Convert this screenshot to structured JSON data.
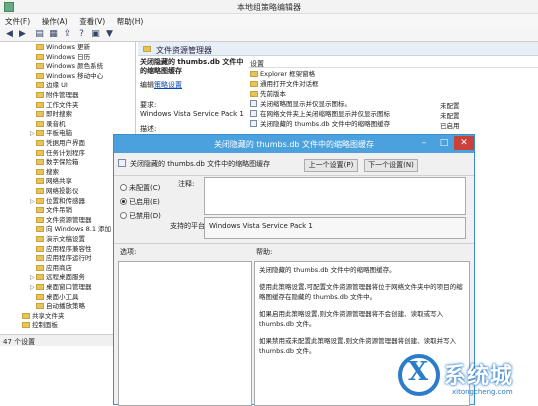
{
  "window": {
    "title": "本地组策略编辑器",
    "menu": [
      "文件(F)",
      "操作(A)",
      "查看(V)",
      "帮助(H)"
    ],
    "status": "47 个设置"
  },
  "tree": [
    {
      "label": "Windows 更新",
      "exp": ""
    },
    {
      "label": "Windows 日历",
      "exp": ""
    },
    {
      "label": "Windows 颜色系统",
      "exp": ""
    },
    {
      "label": "Windows 移动中心",
      "exp": ""
    },
    {
      "label": "边缘 UI",
      "exp": ""
    },
    {
      "label": "附件管理器",
      "exp": ""
    },
    {
      "label": "工作文件夹",
      "exp": ""
    },
    {
      "label": "即时搜索",
      "exp": ""
    },
    {
      "label": "录音机",
      "exp": ""
    },
    {
      "label": "平板电脑",
      "exp": "▷"
    },
    {
      "label": "凭据用户界面",
      "exp": ""
    },
    {
      "label": "任务计划程序",
      "exp": ""
    },
    {
      "label": "数字保险箱",
      "exp": ""
    },
    {
      "label": "搜索",
      "exp": ""
    },
    {
      "label": "网络共享",
      "exp": ""
    },
    {
      "label": "网络投影仪",
      "exp": ""
    },
    {
      "label": "位置和传感器",
      "exp": "▷"
    },
    {
      "label": "文件吊销",
      "exp": ""
    },
    {
      "label": "文件资源管理器",
      "exp": ""
    },
    {
      "label": "向 Windows 8.1 添加",
      "exp": ""
    },
    {
      "label": "演示文稿设置",
      "exp": ""
    },
    {
      "label": "应用程序兼容性",
      "exp": ""
    },
    {
      "label": "应用程序运行时",
      "exp": ""
    },
    {
      "label": "应用商店",
      "exp": ""
    },
    {
      "label": "远程桌面服务",
      "exp": "▷"
    },
    {
      "label": "桌面窗口管理器",
      "exp": "▷"
    },
    {
      "label": "桌面小工具",
      "exp": ""
    },
    {
      "label": "自动播放策略",
      "exp": ""
    },
    {
      "label": "共享文件夹",
      "exp": ""
    },
    {
      "label": "控制面板",
      "exp": ""
    }
  ],
  "panel": {
    "header": "文件资源管理器",
    "desc_title": "关闭隐藏的 thumbs.db 文件中的缩略图缓存",
    "edit_prefix": "编辑",
    "edit_link": "策略设置",
    "req_label": "要求:",
    "req_value": "Windows Vista Service Pack 1",
    "desc_label": "描述:",
    "col_setting": "设置",
    "rows": [
      {
        "label": "Explorer 框架窗格",
        "type": "folder",
        "state": ""
      },
      {
        "label": "通用打开文件对话框",
        "type": "folder",
        "state": ""
      },
      {
        "label": "先前版本",
        "type": "folder",
        "state": ""
      },
      {
        "label": "关闭缩略图显示并仅显示图标。",
        "type": "policy",
        "state": "未配置"
      },
      {
        "label": "在网络文件夹上关闭缩略图显示并仅显示图标",
        "type": "policy",
        "state": "未配置"
      },
      {
        "label": "关闭隐藏的 thumbs.db 文件中的缩略图缓存",
        "type": "policy",
        "state": "已启用"
      }
    ]
  },
  "dialog": {
    "title": "关闭隐藏的 thumbs.db 文件中的缩略图缓存",
    "header_label": "关闭隐藏的 thumbs.db 文件中的缩略图缓存",
    "prev_button": "上一个设置(P)",
    "next_button": "下一个设置(N)",
    "radio_not_configured": "未配置(C)",
    "radio_enabled": "已启用(E)",
    "radio_disabled": "已禁用(D)",
    "selected": "enabled",
    "comment_label": "注释:",
    "supported_label": "支持的平台:",
    "supported_value": "Windows Vista Service Pack 1",
    "options_label": "选项:",
    "help_label": "帮助:",
    "help_paragraphs": [
      "关闭隐藏的 thumbs.db 文件中的缩略图缓存。",
      "使用此策略设置,可配置文件资源管理器将位于网络文件夹中的项目的缩略图缓存在隐藏的 thumbs.db 文件中。",
      "如果启用此策略设置,则文件资源管理器将不会创建、读取或写入 thumbs.db 文件。",
      "如果禁用或未配置此策略设置,则文件资源管理器将创建、读取并写入 thumbs.db 文件。"
    ]
  },
  "watermark": {
    "glyph": "X",
    "name": "系统城",
    "site": "xitongcheng.com"
  }
}
